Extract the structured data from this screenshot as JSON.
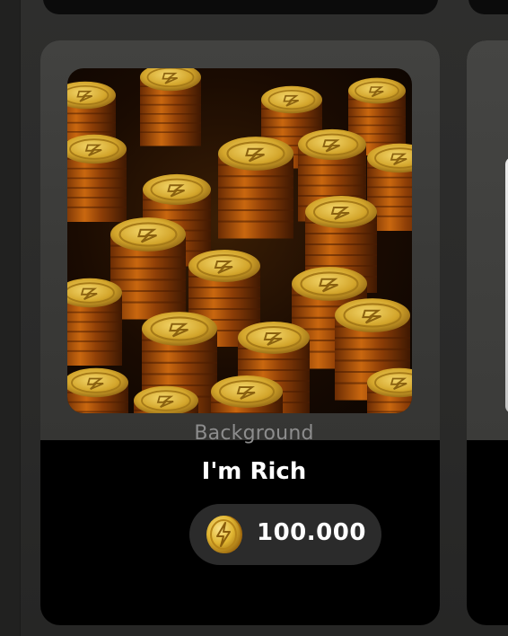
{
  "card": {
    "category": "Background",
    "title": "I'm Rich",
    "price": "100.000",
    "thumbnail_icon": "gold-coin-stacks-image",
    "price_icon": "lightning-coin-icon",
    "colors": {
      "card_bg": "#000000",
      "thumb_panel": "#3f3f3d",
      "category_text": "#8d8d8d",
      "title_text": "#ffffff",
      "price_pill": "#2b2b2b",
      "coin_gold": "#e0b531"
    }
  }
}
